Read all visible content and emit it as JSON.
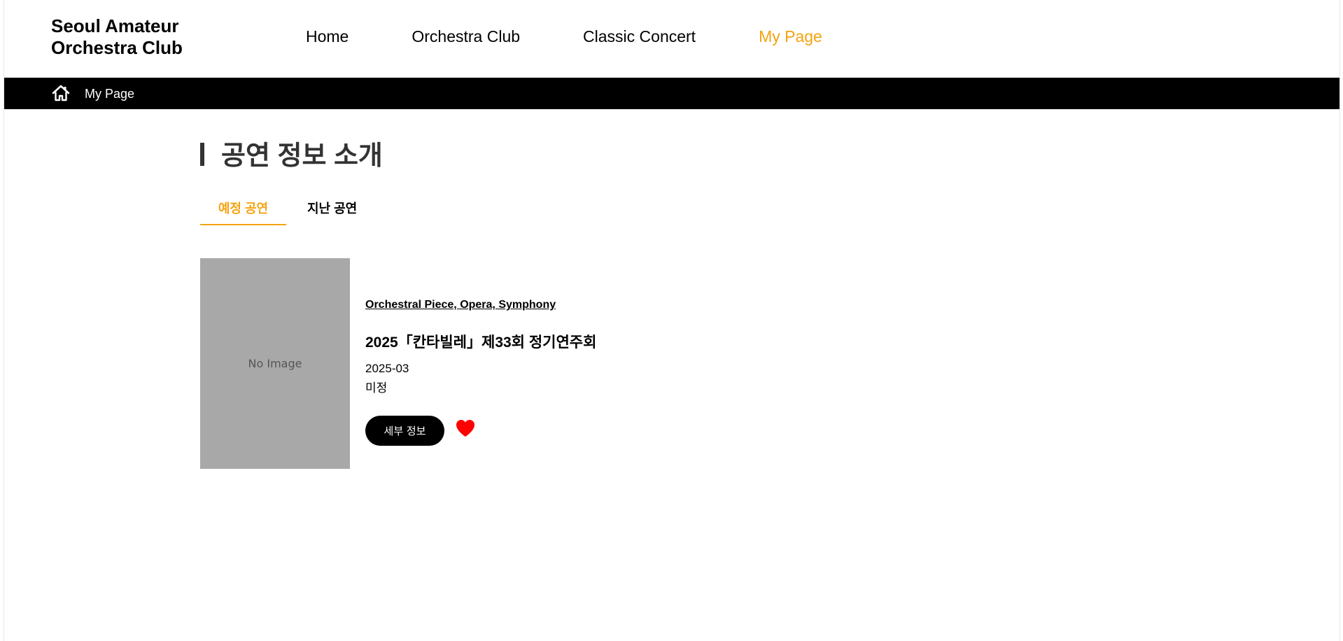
{
  "header": {
    "logo": "Seoul Amateur\nOrchestra Club",
    "nav": [
      {
        "label": "Home"
      },
      {
        "label": "Orchestra Club"
      },
      {
        "label": "Classic Concert"
      },
      {
        "label": "My Page"
      }
    ],
    "active_nav": "My Page"
  },
  "breadcrumb": {
    "icon": "home-icon",
    "label": "My Page"
  },
  "section": {
    "title": "공연 정보 소개",
    "tabs": [
      {
        "label": "예정 공연"
      },
      {
        "label": "지난 공연"
      }
    ],
    "active_tab": "예정 공연"
  },
  "concerts": [
    {
      "poster_text": "No Image",
      "genre": "Orchestral Piece, Opera, Symphony",
      "title": "2025「칸타빌레」제33회 정기연주회",
      "date": "2025-03",
      "venue": "미정",
      "detail_button": "세부 정보",
      "favorite_icon": "heart-icon"
    }
  ],
  "colors": {
    "accent": "#f5a312",
    "breadcrumb_bg": "#000000",
    "heart": "#ff0000",
    "poster_placeholder": "#a8a8a8"
  }
}
